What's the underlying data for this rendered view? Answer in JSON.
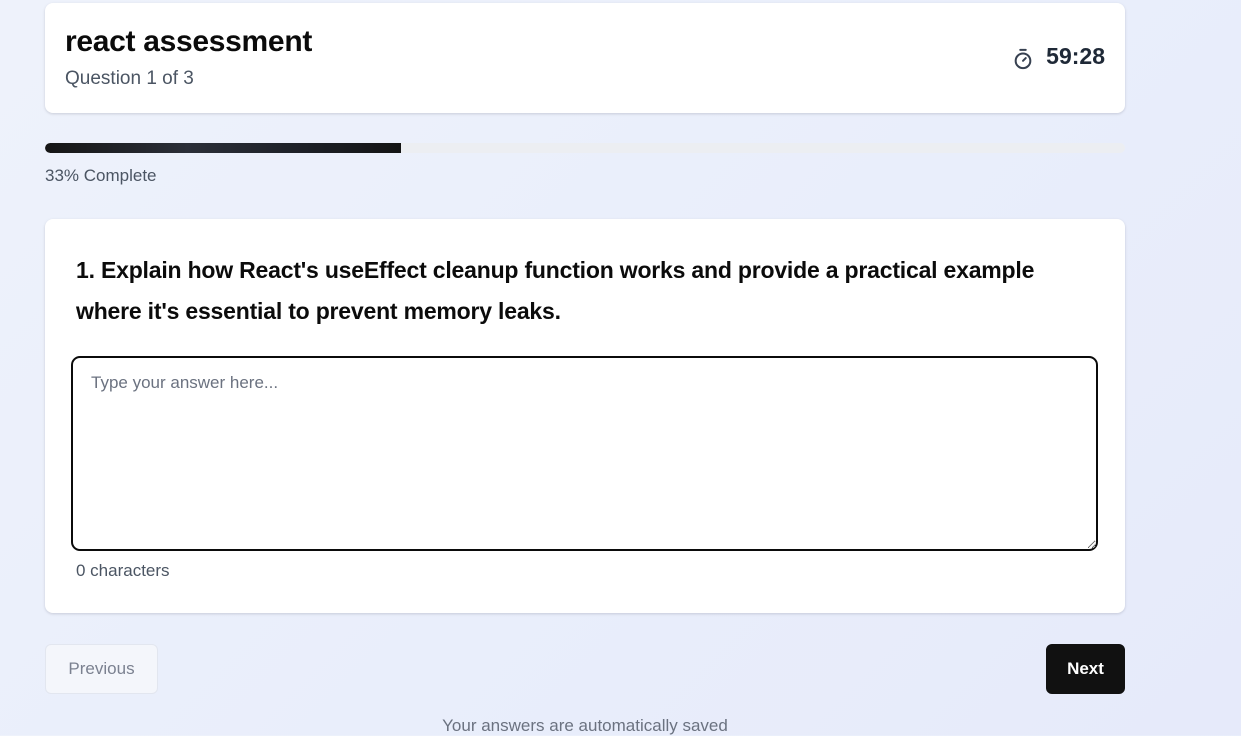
{
  "header": {
    "title": "react assessment",
    "subtitle": "Question 1 of 3",
    "timer_icon": "stopwatch-icon",
    "timer": "59:28"
  },
  "progress": {
    "fraction": 0.33,
    "label": "33% Complete"
  },
  "question": {
    "text": "1. Explain how React's useEffect cleanup function works and provide a practical example where it's essential to prevent memory leaks.",
    "answer_value": "",
    "answer_placeholder": "Type your answer here...",
    "char_count": "0 characters"
  },
  "nav": {
    "previous_label": "Previous",
    "next_label": "Next"
  },
  "footer": {
    "autosave_note": "Your answers are automatically saved"
  },
  "colors": {
    "primary": "#111111",
    "background": "#eef2fb",
    "muted_text": "#4b5563"
  }
}
